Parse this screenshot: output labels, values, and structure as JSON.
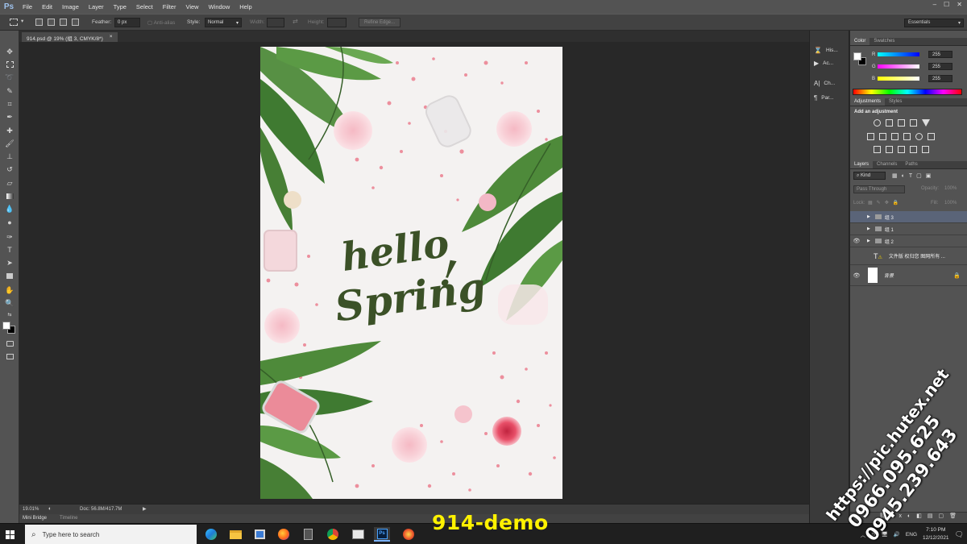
{
  "app": {
    "logo": "Ps"
  },
  "menu": [
    "File",
    "Edit",
    "Image",
    "Layer",
    "Type",
    "Select",
    "Filter",
    "View",
    "Window",
    "Help"
  ],
  "window_controls": {
    "minimize": "–",
    "maximize": "☐",
    "close": "✕"
  },
  "options": {
    "feather_label": "Feather:",
    "feather_value": "0 px",
    "antialias_label": "Anti-alias",
    "style_label": "Style:",
    "style_value": "Normal",
    "width_label": "Width:",
    "height_label": "Height:",
    "refine_edge": "Refine Edge...",
    "workspace": "Essentials"
  },
  "document": {
    "tab_title": "914.psd @ 19% (组 3, CMYK/8*)",
    "tab_close": "×"
  },
  "status": {
    "zoom": "19.01%",
    "doc_size": "Doc: 56.8M/417.7M"
  },
  "bottom_tabs": [
    "Mini Bridge",
    "Timeline"
  ],
  "artwork": {
    "line1": "hello",
    "line2": "Spring",
    "exclaim": "!"
  },
  "icon_strip": [
    {
      "label": "His...",
      "icon": "history-icon"
    },
    {
      "label": "Ac...",
      "icon": "actions-icon"
    },
    {
      "label": "Ch...",
      "icon": "character-icon"
    },
    {
      "label": "Par...",
      "icon": "paragraph-icon"
    }
  ],
  "color_panel": {
    "tabs": [
      "Color",
      "Swatches"
    ],
    "channels": [
      {
        "label": "R",
        "value": "255",
        "color": "#00d8ff"
      },
      {
        "label": "G",
        "value": "255",
        "color": "#ff3cff"
      },
      {
        "label": "B",
        "value": "255",
        "color": "#ffff3c"
      }
    ]
  },
  "adjustments_panel": {
    "tabs": [
      "Adjustments",
      "Styles"
    ],
    "heading": "Add an adjustment"
  },
  "layers_panel": {
    "tabs": [
      "Layers",
      "Channels",
      "Paths"
    ],
    "kind": "Kind",
    "blend_mode": "Pass Through",
    "opacity_label": "Opacity:",
    "opacity_value": "100%",
    "lock_label": "Lock:",
    "fill_label": "Fill:",
    "fill_value": "100%",
    "layers": [
      {
        "name": "组 3",
        "type": "group",
        "visible": false,
        "selected": true
      },
      {
        "name": "组 1",
        "type": "group",
        "visible": false,
        "selected": false
      },
      {
        "name": "组 2",
        "type": "group",
        "visible": true,
        "selected": false
      },
      {
        "name": "文件版 权归您 图网所有 ...",
        "type": "text",
        "visible": false,
        "selected": false
      },
      {
        "name": "背景",
        "type": "background",
        "visible": true,
        "selected": false
      }
    ]
  },
  "taskbar": {
    "search_placeholder": "Type here to search",
    "language": "ENG",
    "time": "7:10 PM",
    "date": "12/12/2021"
  },
  "overlay": {
    "demo_label": "914-demo",
    "watermark": [
      "https://pic.hutex.net",
      "0966.095.625",
      "0945.239.643"
    ]
  }
}
